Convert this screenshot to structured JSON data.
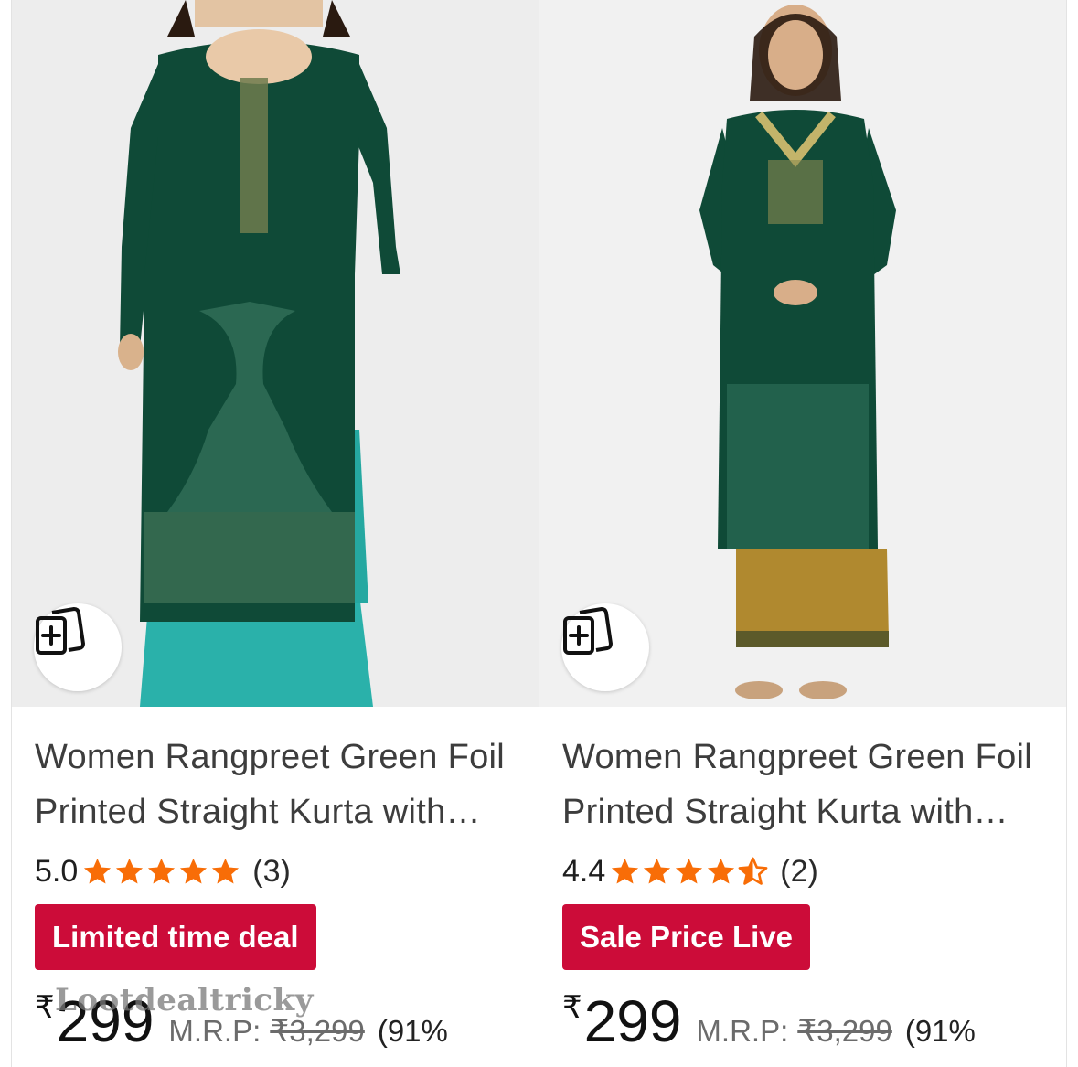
{
  "products": [
    {
      "title": "Women Rangpreet Green Foil Printed Straight Kurta with Palazzo",
      "rating": "5.0",
      "stars": 5,
      "review_count": "(3)",
      "badge": "Limited time deal",
      "currency": "₹",
      "price": "299",
      "mrp_label": "M.R.P:",
      "mrp_value": "₹3,299",
      "discount": "(91%",
      "kurta_color": "#0f4a37",
      "pant_color": "#2ab1aa",
      "compare_icon": "compare-cards-icon"
    },
    {
      "title": "Women Rangpreet Green Foil Printed Straight Kurta with Palazzo",
      "rating": "4.4",
      "stars": 4.5,
      "review_count": "(2)",
      "badge": "Sale Price Live",
      "currency": "₹",
      "price": "299",
      "mrp_label": "M.R.P:",
      "mrp_value": "₹3,299",
      "discount": "(91%",
      "kurta_color": "#0f4a37",
      "pant_color": "#b0892f",
      "compare_icon": "compare-cards-icon"
    }
  ],
  "watermark": "Lootdealtricky",
  "colors": {
    "badge_bg": "#cc0c39",
    "star": "#f86d07",
    "title_text": "#3d3d3d"
  }
}
